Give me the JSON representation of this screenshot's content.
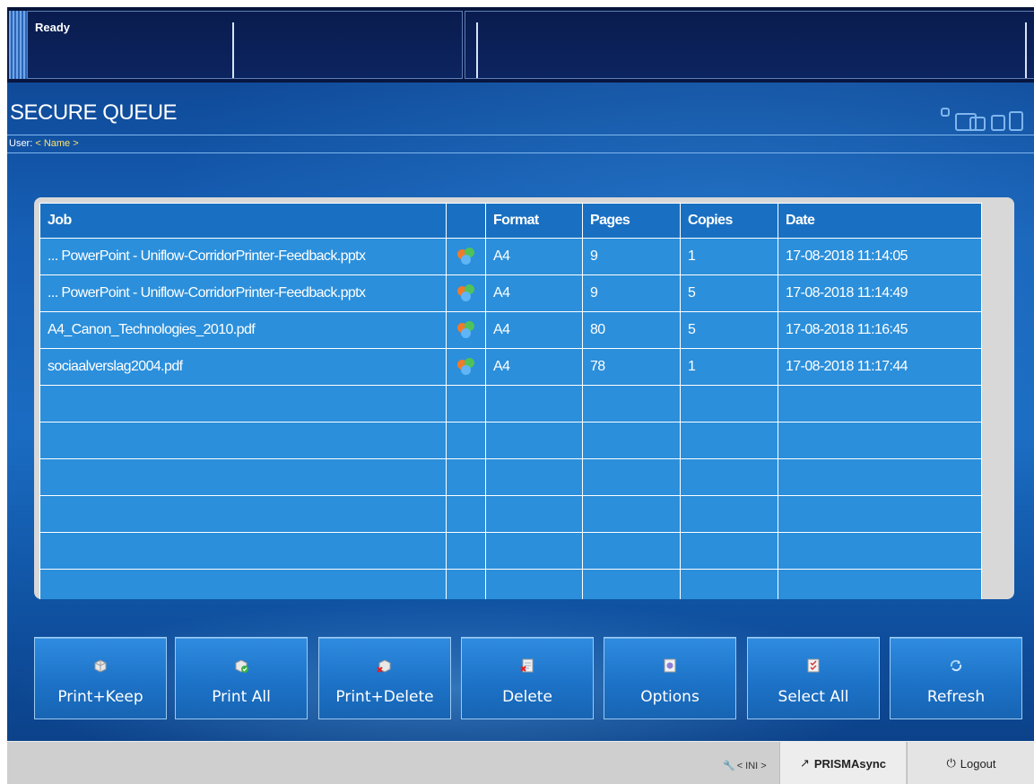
{
  "status": {
    "text": "Ready"
  },
  "header": {
    "title": "SECURE QUEUE",
    "user_label": "User:",
    "user_value": "< Name >"
  },
  "table": {
    "columns": [
      "Job",
      "",
      "Format",
      "Pages",
      "Copies",
      "Date"
    ],
    "rows": [
      {
        "job": "... PowerPoint - Uniflow-CorridorPrinter-Feedback.pptx",
        "icon": "color-print-icon",
        "format": "A4",
        "pages": "9",
        "copies": "1",
        "date": "17-08-2018 11:14:05"
      },
      {
        "job": "... PowerPoint - Uniflow-CorridorPrinter-Feedback.pptx",
        "icon": "color-print-icon",
        "format": "A4",
        "pages": "9",
        "copies": "5",
        "date": "17-08-2018 11:14:49"
      },
      {
        "job": "A4_Canon_Technologies_2010.pdf",
        "icon": "color-print-icon",
        "format": "A4",
        "pages": "80",
        "copies": "5",
        "date": "17-08-2018 11:16:45"
      },
      {
        "job": "sociaalverslag2004.pdf",
        "icon": "color-print-icon",
        "format": "A4",
        "pages": "78",
        "copies": "1",
        "date": "17-08-2018 11:17:44"
      }
    ],
    "empty_rows": 6
  },
  "buttons": [
    {
      "label": "Print+Keep",
      "icon": "print-keep-icon"
    },
    {
      "label": "Print All",
      "icon": "print-all-icon"
    },
    {
      "label": "Print+Delete",
      "icon": "print-delete-icon"
    },
    {
      "label": "Delete",
      "icon": "delete-icon"
    },
    {
      "label": "Options",
      "icon": "options-icon"
    },
    {
      "label": "Select All",
      "icon": "select-all-icon"
    },
    {
      "label": "Refresh",
      "icon": "refresh-icon"
    }
  ],
  "footer": {
    "ini_label": "< INI >",
    "prisma_label": "PRISMAsync",
    "logout_label": "Logout"
  }
}
